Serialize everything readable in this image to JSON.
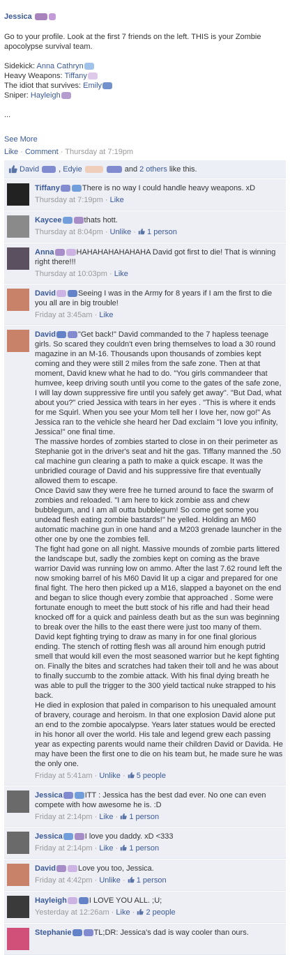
{
  "post": {
    "author": "Jessica",
    "lines": [
      "Go to your profile. Look at the first 7 friends on the left. THIS is your Zombie apocolypse survival team."
    ],
    "team": [
      {
        "role": "Sidekick:",
        "name": "Anna Cathryn"
      },
      {
        "role": "Heavy Weapons:",
        "name": "Tiffany"
      },
      {
        "role": "The idiot that survives:",
        "name": "Emily"
      },
      {
        "role": "Sniper:",
        "name": "Hayleigh"
      }
    ],
    "ellipsis": "...",
    "see_more": "See More",
    "actions": {
      "like": "Like",
      "comment": "Comment",
      "time": "Thursday at 7:19pm"
    }
  },
  "likes_bar": {
    "name1": "David",
    "name2": "Edyie",
    "and": "and",
    "others": "2 others",
    "suffix": "like this."
  },
  "comments": [
    {
      "name": "Tiffany",
      "text": "There is no way I could handle heavy weapons. xD",
      "time": "Thursday at 7:19pm",
      "action": "Like",
      "likes": "",
      "avatar_color": "#222"
    },
    {
      "name": "Kaycee",
      "text": "thats hott.",
      "time": "Thursday at 8:04pm",
      "action": "Unlike",
      "likes": "1 person",
      "avatar_color": "#8a8a8a"
    },
    {
      "name": "Anna",
      "text": "HAHAHAHAHAHAHA David got first to die! That is winning right there!!!",
      "time": "Thursday at 10:03pm",
      "action": "Like",
      "likes": "",
      "avatar_color": "#5a5060"
    },
    {
      "name": "David",
      "text": "Seeing I was in the Army for 8 years if I am the first to die you all are in big trouble!",
      "time": "Friday at 3:45am",
      "action": "Like",
      "likes": "",
      "avatar_color": "#c9826a"
    },
    {
      "name": "David",
      "text": "\"Get back!\" David commanded to the 7 hapless teenage girls. So scared they couldn't even bring themselves to load a 30 round magazine in an M-16. Thousands upon thousands of zombies kept coming and they were still 2 miles from the safe zone. Then at that moment, David knew what he had to do. \"You girls commandeer that humvee, keep driving south until you come to the gates of the safe zone, I will lay down suppressive fire until you safely get away\". \"But Dad, what about you?\" cried Jessica with tears in her eyes . \"This is where it ends for me Squirl. When you see your Mom tell her I love her, now go!\" As Jessica ran to the vehicle she heard her Dad exclaim \"I love you infinity, Jessica!\" one final time.\nThe massive hordes of zombies started to close in on their perimeter as Stephanie got in the driver's seat and hit the gas. Tiffany manned the .50 cal machine gun clearing a path to make a quick escape. It was the unbridled courage of David and his suppressive fire that eventually allowed them to escape.\nOnce David saw they were free he turned around to face the swarm of zombies and reloaded. \"I am here to kick zombie ass and chew bubblegum, and I am all outta bubblegum! So come get some you undead flesh eating zombie bastards!\" he yelled. Holding an M60 automatic machine gun in one hand and a M203 grenade launcher in the other one by one the zombies fell.\nThe fight had gone on all night. Massive mounds of zombie parts littered the landscape but, sadly the zombies kept on coming as the brave warrior David was running low on ammo. After the last 7.62 round left the now smoking barrel of his M60 David lit up a cigar and prepared for one final fight. The hero then picked up a M16, slapped a bayonet on the end and began to slice though every zombie that approached . Some were fortunate enough to meet the butt stock of his rifle and had their head knocked off for a quick and painless death but as the sun was beginning to break over the hills to the east there were just too many of them.\nDavid kept fighting trying to draw as many in for one final glorious ending. The stench of rotting flesh was all around him enough putrid smell that would kill even the most seasoned warrior but he kept fighting on. Finally the bites and scratches had taken their toll and he was about to finally succumb to the zombie attack. With his final dying breath he was able to pull the trigger to the 300 yield tactical nuke strapped to his back.\nHe died in explosion that paled in comparison to his unequaled amount of bravery, courage and heroism. In that one explosion David alone put an end to the zombie apocalypse. Years later statues would be erected in his honor all over the world. His tale and legend grew each passing year as expecting parents would name their children David or Davida. He may have been the first one to die on his team but, he made sure he was the only one.",
      "time": "Friday at 5:41am",
      "action": "Unlike",
      "likes": "5 people",
      "avatar_color": "#c9826a"
    },
    {
      "name": "Jessica",
      "text": "ITT : Jessica has the best dad ever. No one can even compete with how awesome he is. :D",
      "time": "Friday at 2:14pm",
      "action": "Like",
      "likes": "1 person",
      "avatar_color": "#6a6a6a"
    },
    {
      "name": "Jessica",
      "text": "I love you daddy. xD <333",
      "time": "Friday at 2:14pm",
      "action": "Like",
      "likes": "1 person",
      "avatar_color": "#6a6a6a"
    },
    {
      "name": "David",
      "text": "Love you too, Jessica.",
      "time": "Friday at 4:42pm",
      "action": "Unlike",
      "likes": "1 person",
      "avatar_color": "#c9826a"
    },
    {
      "name": "Hayleigh",
      "text": "I LOVE YOU ALL. ;U;",
      "time": "Yesterday at 12:26am",
      "action": "Like",
      "likes": "2 people",
      "avatar_color": "#3a3a3a"
    },
    {
      "name": "Stephanie",
      "text": "TL;DR: Jessica's dad is way cooler than ours.",
      "time": "",
      "action": "",
      "likes": "",
      "avatar_color": "#d0507a"
    }
  ],
  "colors": {
    "link": "#3b5998",
    "comment_bg": "#edeff4",
    "meta": "#999999"
  }
}
